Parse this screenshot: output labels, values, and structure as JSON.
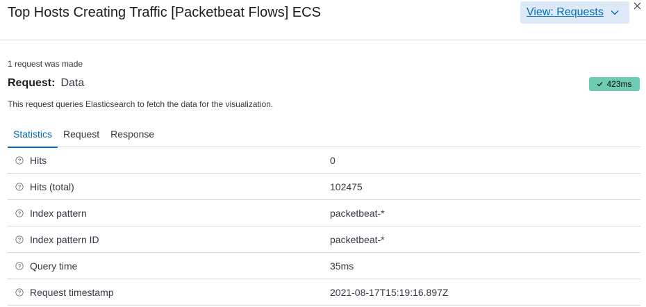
{
  "header": {
    "title": "Top Hosts Creating Traffic [Packetbeat Flows] ECS",
    "view_button_label": "View: Requests",
    "chevron_icon": "chevron-down-icon",
    "close_icon": "close-icon"
  },
  "request": {
    "count_text": "1 request was made",
    "label": "Request:",
    "name": "Data",
    "duration_badge": "423ms",
    "badge_icon": "check-icon",
    "description": "This request queries Elasticsearch to fetch the data for the visualization."
  },
  "tabs": [
    {
      "label": "Statistics",
      "active": true
    },
    {
      "label": "Request",
      "active": false
    },
    {
      "label": "Response",
      "active": false
    }
  ],
  "statistics": [
    {
      "name": "Hits",
      "value": "0"
    },
    {
      "name": "Hits (total)",
      "value": "102475"
    },
    {
      "name": "Index pattern",
      "value": "packetbeat-*"
    },
    {
      "name": "Index pattern ID",
      "value": "packetbeat-*"
    },
    {
      "name": "Query time",
      "value": "35ms"
    },
    {
      "name": "Request timestamp",
      "value": "2021-08-17T15:19:16.897Z"
    }
  ],
  "colors": {
    "accent": "#006bb8",
    "badge_success": "#6dccb1",
    "view_button_bg": "#dde9f6",
    "border": "#d3dae6"
  }
}
